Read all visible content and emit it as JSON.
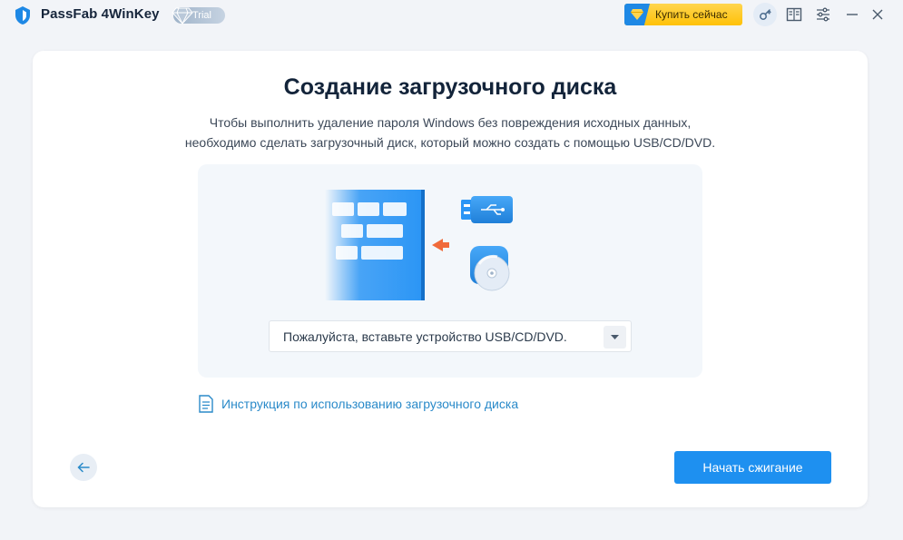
{
  "window": {
    "app_title": "PassFab 4WinKey",
    "badge": "Trial",
    "buy_label": "Купить сейчас"
  },
  "icons": {
    "logo": "passfab-shield-icon",
    "key": "key-icon",
    "manual": "book-icon",
    "settings": "sliders-icon",
    "minimize": "minimize-icon",
    "close": "close-icon"
  },
  "main": {
    "title": "Создание загрузочного диска",
    "description_line1": "Чтобы выполнить удаление пароля Windows без повреждения исходных данных,",
    "description_line2": "необходимо сделать загрузочный диск, который можно создать с помощью USB/CD/DVD.",
    "device_select": {
      "selected": "Пожалуйста, вставьте устройство USB/CD/DVD."
    },
    "guide_link": "Инструкция по использованию загрузочного диска",
    "burn_button": "Начать сжигание"
  },
  "colors": {
    "accent": "#1e90f0",
    "link": "#2a8ac9",
    "buy": "#ffc107",
    "arrow": "#f06a3a"
  }
}
